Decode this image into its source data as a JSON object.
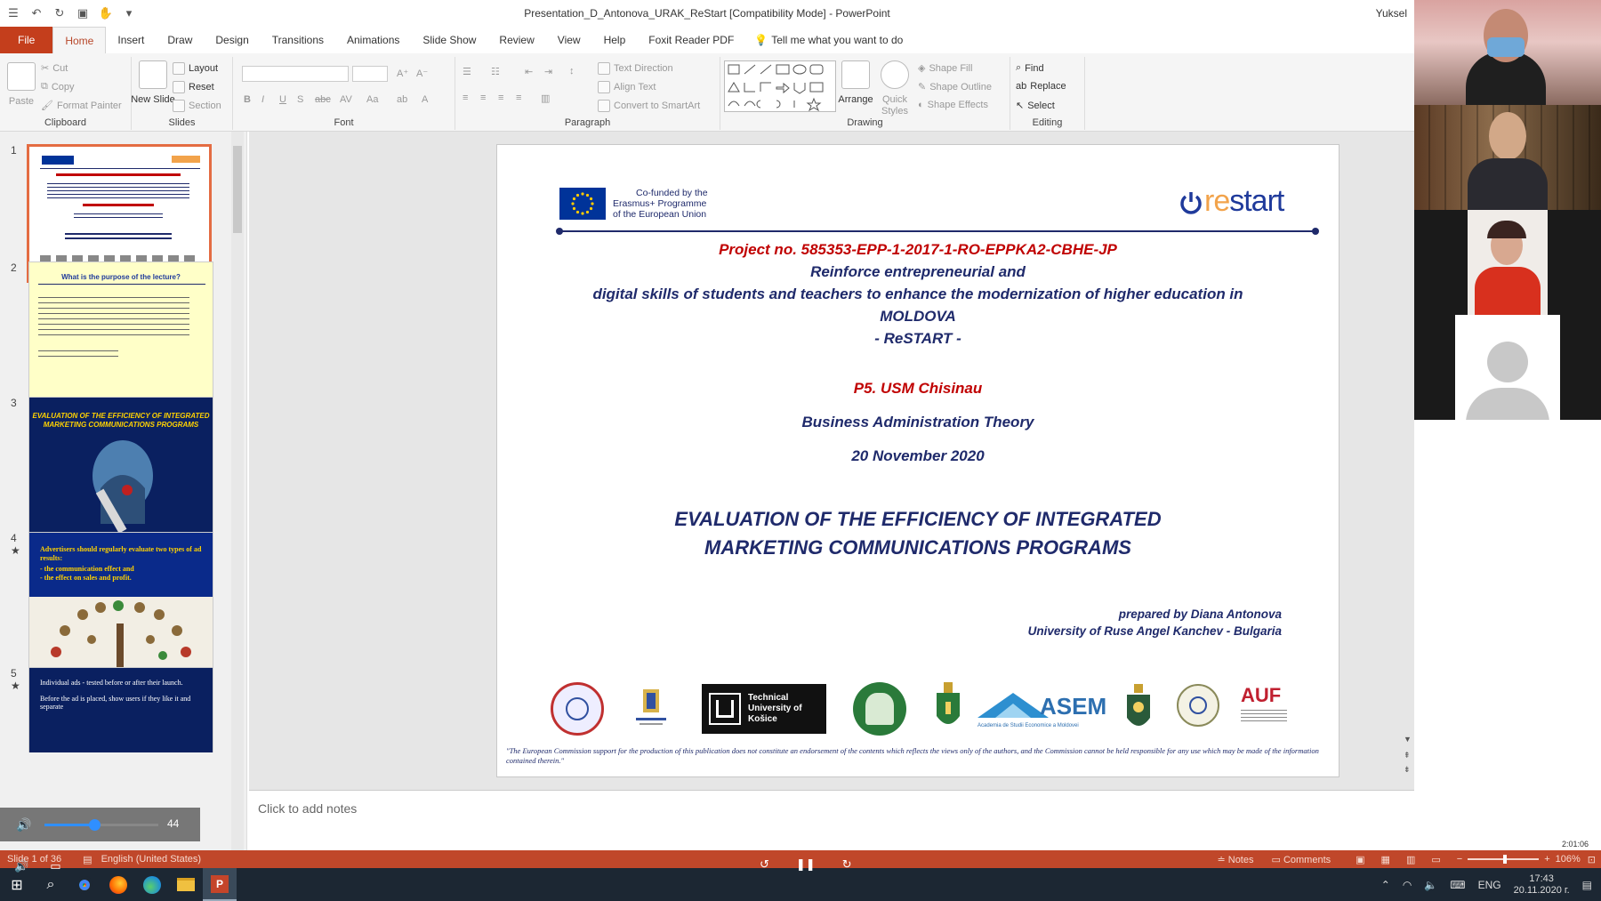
{
  "window": {
    "title": "Presentation_D_Antonova_URAK_ReStart [Compatibility Mode]  -  PowerPoint",
    "user": "Yuksel"
  },
  "tabs": [
    "File",
    "Home",
    "Insert",
    "Draw",
    "Design",
    "Transitions",
    "Animations",
    "Slide Show",
    "Review",
    "View",
    "Help",
    "Foxit Reader PDF"
  ],
  "tell_me": "Tell me what you want to do",
  "ribbon": {
    "clipboard": {
      "label": "Clipboard",
      "paste": "Paste",
      "cut": "Cut",
      "copy": "Copy",
      "format_painter": "Format Painter"
    },
    "slides": {
      "label": "Slides",
      "new_slide": "New Slide",
      "layout": "Layout",
      "reset": "Reset",
      "section": "Section"
    },
    "font": {
      "label": "Font",
      "bold": "B",
      "italic": "I",
      "underline": "U",
      "strike": "S",
      "abc": "abc"
    },
    "paragraph": {
      "label": "Paragraph",
      "text_direction": "Text Direction",
      "align_text": "Align Text",
      "convert": "Convert to SmartArt"
    },
    "drawing": {
      "label": "Drawing",
      "arrange": "Arrange",
      "quick_styles": "Quick Styles",
      "shape_fill": "Shape Fill",
      "shape_outline": "Shape Outline",
      "shape_effects": "Shape Effects"
    },
    "editing": {
      "label": "Editing",
      "find": "Find",
      "replace": "Replace",
      "select": "Select"
    }
  },
  "thumbnails": [
    {
      "num": "1",
      "star": ""
    },
    {
      "num": "2",
      "star": "",
      "title": "What is the purpose of the lecture?"
    },
    {
      "num": "3",
      "star": "",
      "title": "EVALUATION OF THE EFFICIENCY OF INTEGRATED MARKETING COMMUNICATIONS PROGRAMS"
    },
    {
      "num": "4",
      "star": "★",
      "title": "Advertisers should regularly evaluate two types of ad results:",
      "l1": "- the communication effect and",
      "l2": "- the effect on sales and profit."
    },
    {
      "num": "5",
      "star": "★",
      "title": "Individual ads - tested before or after their launch.",
      "l1": "Before the ad is placed, show users if they like it and separate"
    }
  ],
  "slide": {
    "eu_text": [
      "Co-funded by the",
      "Erasmus+ Programme",
      "of the European Union"
    ],
    "restart_logo": {
      "re": "re",
      "start": "start"
    },
    "project": "Project no. 585353-EPP-1-2017-1-RO-EPPKA2-CBHE-JP",
    "line1": "Reinforce entrepreneurial and",
    "line2": "digital skills of students and teachers to enhance the modernization of higher education in",
    "line3": "MOLDOVA",
    "line4": "- ReSTART -",
    "partner": "P5. USM Chisinau",
    "course": "Business Administration Theory",
    "date": "20 November 2020",
    "heading1": "EVALUATION OF THE EFFICIENCY OF INTEGRATED",
    "heading2": "MARKETING COMMUNICATIONS PROGRAMS",
    "author": "prepared by Diana Antonova",
    "university": "University of Ruse Angel Kanchev - Bulgaria",
    "tuke": "Technical University of Košice",
    "asem": "ASEM",
    "asem_sub": "Academia de Studii Economice a Moldovei",
    "auf": "AUF",
    "disclaimer": "\"The European Commission support for the production of this publication does not constitute an endorsement of the contents which reflects the views only of the authors, and the Commission cannot be held responsible for any use which may be made of the information contained therein.\""
  },
  "notes_placeholder": "Click to add notes",
  "status": {
    "slide": "Slide 1 of 36",
    "lang": "English (United States)",
    "notes": "Notes",
    "comments": "Comments",
    "zoom": "106%",
    "timer": "2:01:06"
  },
  "media": {
    "volume": "44",
    "volume_level": 0.44
  },
  "taskbar": {
    "lang": "ENG",
    "time": "17:43",
    "date": "20.11.2020 г."
  },
  "colors": {
    "file_tab": "#c43e1c",
    "title_red": "#c00000",
    "title_navy": "#1f2a6b",
    "status": "#c0472a"
  }
}
